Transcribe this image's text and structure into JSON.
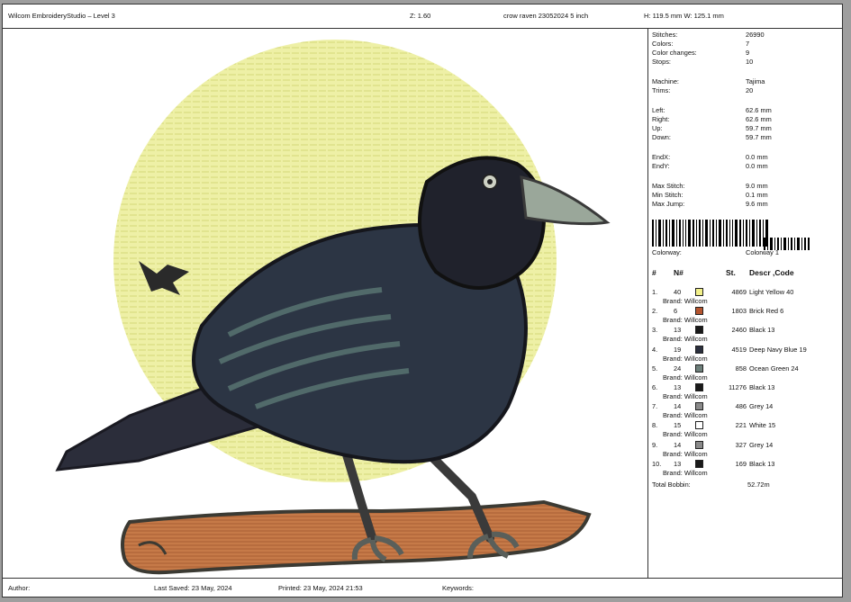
{
  "header": {
    "app_title": "Wilcom EmbroideryStudio – Level 3",
    "zoom": "Z: 1.60",
    "design_name": "crow raven 23052024 5 inch",
    "size": "H: 119.5 mm   W: 125.1 mm"
  },
  "stats": {
    "stitches": {
      "label": "Stitches:",
      "value": "26990"
    },
    "colors": {
      "label": "Colors:",
      "value": "7"
    },
    "color_changes": {
      "label": "Color changes:",
      "value": "9"
    },
    "stops": {
      "label": "Stops:",
      "value": "10"
    },
    "machine": {
      "label": "Machine:",
      "value": "Tajima"
    },
    "trims": {
      "label": "Trims:",
      "value": "20"
    },
    "left": {
      "label": "Left:",
      "value": "62.6 mm"
    },
    "right": {
      "label": "Right:",
      "value": "62.6 mm"
    },
    "up": {
      "label": "Up:",
      "value": "59.7 mm"
    },
    "down": {
      "label": "Down:",
      "value": "59.7 mm"
    },
    "endx": {
      "label": "EndX:",
      "value": "0.0 mm"
    },
    "endy": {
      "label": "EndY:",
      "value": "0.0 mm"
    },
    "max_stitch": {
      "label": "Max Stitch:",
      "value": "9.0 mm"
    },
    "min_stitch": {
      "label": "Min Stitch:",
      "value": "0.1 mm"
    },
    "max_jump": {
      "label": "Max Jump:",
      "value": "9.6 mm"
    }
  },
  "colorway": {
    "label": "Colorway:",
    "value": "Colorway 1"
  },
  "table": {
    "headers": [
      "#",
      "N#",
      "St.",
      "Descr ,Code"
    ],
    "rows": [
      {
        "idx": "1.",
        "num": "40",
        "color": "#f2f08a",
        "stitches": "4869",
        "descr": "Light Yellow 40",
        "brand": "Brand: Willcom"
      },
      {
        "idx": "2.",
        "num": "6",
        "color": "#b5552f",
        "stitches": "1803",
        "descr": "Brick Red 6",
        "brand": "Brand: Willcom"
      },
      {
        "idx": "3.",
        "num": "13",
        "color": "#1a1a1a",
        "stitches": "2460",
        "descr": "Black 13",
        "brand": "Brand: Willcom"
      },
      {
        "idx": "4.",
        "num": "19",
        "color": "#2b2f3d",
        "stitches": "4519",
        "descr": "Deep Navy Blue 19",
        "brand": "Brand: Willcom"
      },
      {
        "idx": "5.",
        "num": "24",
        "color": "#6d7f7a",
        "stitches": "858",
        "descr": "Ocean Green 24",
        "brand": "Brand: Willcom"
      },
      {
        "idx": "6.",
        "num": "13",
        "color": "#1a1a1a",
        "stitches": "11276",
        "descr": "Black 13",
        "brand": "Brand: Willcom"
      },
      {
        "idx": "7.",
        "num": "14",
        "color": "#8a8a8a",
        "stitches": "486",
        "descr": "Grey 14",
        "brand": "Brand: Willcom"
      },
      {
        "idx": "8.",
        "num": "15",
        "color": "#ffffff",
        "stitches": "221",
        "descr": "White 15",
        "brand": "Brand: Willcom"
      },
      {
        "idx": "9.",
        "num": "14",
        "color": "#8a8a8a",
        "stitches": "327",
        "descr": "Grey 14",
        "brand": "Brand: Willcom"
      },
      {
        "idx": "10.",
        "num": "13",
        "color": "#1a1a1a",
        "stitches": "169",
        "descr": "Black 13",
        "brand": "Brand: Willcom"
      }
    ],
    "total_bobbin_label": "Total Bobbin:",
    "total_bobbin_value": "52.72m"
  },
  "footer": {
    "author": "Author:",
    "last_saved": "Last Saved: 23 May, 2024",
    "printed": "Printed: 23 May, 2024 21:53",
    "keywords": "Keywords:"
  }
}
